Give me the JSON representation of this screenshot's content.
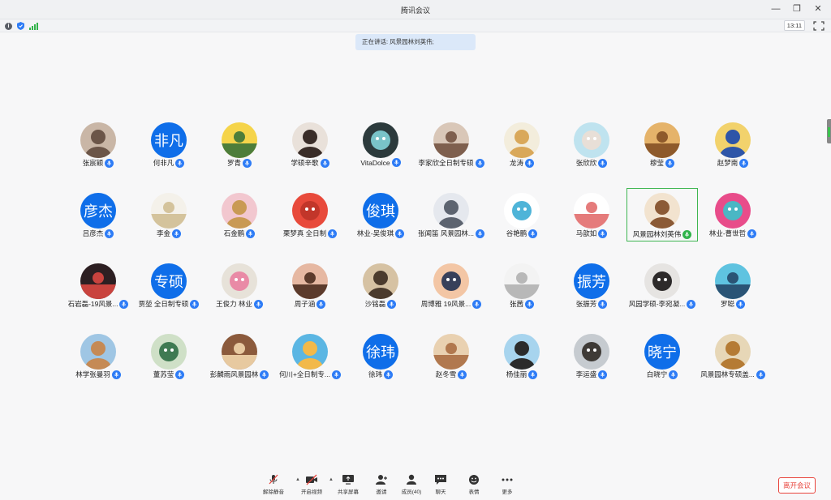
{
  "window": {
    "title": "腾讯会议"
  },
  "status": {
    "time": "13:11"
  },
  "speaking": {
    "text": "正在讲话: 风景园林刘英伟;"
  },
  "participants": [
    {
      "name": "张宸颖",
      "avatar": "photo",
      "colors": [
        "#c9b6a6",
        "#6b5548"
      ]
    },
    {
      "name": "何非凡",
      "avatar": "text",
      "text": "非凡"
    },
    {
      "name": "罗青",
      "avatar": "photo",
      "colors": [
        "#f5d44a",
        "#4d7d3a"
      ]
    },
    {
      "name": "学硕辛歌",
      "avatar": "photo",
      "colors": [
        "#e9e1da",
        "#3a2d28"
      ]
    },
    {
      "name": "VitaDolce",
      "avatar": "photo",
      "colors": [
        "#2c3a3c",
        "#79c3c8"
      ]
    },
    {
      "name": "李家欣全日制专硕",
      "avatar": "photo",
      "colors": [
        "#d9c7b8",
        "#7e5f4e"
      ]
    },
    {
      "name": "龙涛",
      "avatar": "photo",
      "colors": [
        "#f3eddc",
        "#d9a85a"
      ]
    },
    {
      "name": "张欣欣",
      "avatar": "photo",
      "colors": [
        "#bfe3ef",
        "#e8dfd7"
      ]
    },
    {
      "name": "穆莹",
      "avatar": "photo",
      "colors": [
        "#e5b36a",
        "#8e5a2b"
      ]
    },
    {
      "name": "赵梦南",
      "avatar": "photo",
      "colors": [
        "#f2d26c",
        "#2e55a8"
      ]
    },
    {
      "name": "吕彦杰",
      "avatar": "text",
      "text": "彦杰"
    },
    {
      "name": "李金",
      "avatar": "photo",
      "colors": [
        "#f4f1ea",
        "#d4c39c"
      ]
    },
    {
      "name": "石金鹏",
      "avatar": "photo",
      "colors": [
        "#f2c7cf",
        "#c99a54"
      ]
    },
    {
      "name": "栗梦真 全日制",
      "avatar": "photo",
      "colors": [
        "#e84a3b",
        "#c2362a"
      ]
    },
    {
      "name": "林业-吴俊琪",
      "avatar": "text",
      "text": "俊琪"
    },
    {
      "name": "张闻笛 风景园林...",
      "avatar": "photo",
      "colors": [
        "#e5e8ee",
        "#5d6470"
      ]
    },
    {
      "name": "谷艳鹏",
      "avatar": "photo",
      "colors": [
        "#ffffff",
        "#4fb4d8"
      ]
    },
    {
      "name": "马歆如",
      "avatar": "photo",
      "colors": [
        "#ffffff",
        "#e57b7b"
      ]
    },
    {
      "name": "风景园林刘英伟",
      "avatar": "photo",
      "colors": [
        "#f2e3cf",
        "#8b5a36"
      ],
      "active": true
    },
    {
      "name": "林业-曹世哲",
      "avatar": "photo",
      "colors": [
        "#e84c8a",
        "#4ab7c4"
      ]
    },
    {
      "name": "石岩磊-19风景...",
      "avatar": "photo",
      "colors": [
        "#2d1f22",
        "#c9433e"
      ]
    },
    {
      "name": "贾堃 全日制专硕",
      "avatar": "text",
      "text": "专硕"
    },
    {
      "name": "王俊力 林业",
      "avatar": "photo",
      "colors": [
        "#e7e2d9",
        "#e98aa6"
      ]
    },
    {
      "name": "周子涵",
      "avatar": "photo",
      "colors": [
        "#e6b8a2",
        "#5c3b2c"
      ]
    },
    {
      "name": "沙铭磊",
      "avatar": "photo",
      "colors": [
        "#d6c2a3",
        "#4b3b2d"
      ]
    },
    {
      "name": "周博雅 19风景...",
      "avatar": "photo",
      "colors": [
        "#f3c6a5",
        "#38405a"
      ]
    },
    {
      "name": "张茜",
      "avatar": "photo",
      "colors": [
        "#f3f3f3",
        "#b8b8b8"
      ]
    },
    {
      "name": "张振芳",
      "avatar": "text",
      "text": "振芳"
    },
    {
      "name": "风园学硕-李宛凝...",
      "avatar": "photo",
      "colors": [
        "#e6e4e2",
        "#2d2a2a"
      ]
    },
    {
      "name": "罗聪",
      "avatar": "photo",
      "colors": [
        "#5fc3e0",
        "#2a5475"
      ]
    },
    {
      "name": "林学张曼羽",
      "avatar": "photo",
      "colors": [
        "#9fc6e4",
        "#c58a55"
      ]
    },
    {
      "name": "董苏莹",
      "avatar": "photo",
      "colors": [
        "#cfe0c7",
        "#3f7a52"
      ]
    },
    {
      "name": "彭麟雨风景园林",
      "avatar": "photo",
      "colors": [
        "#8b5a3c",
        "#e7c9a0"
      ]
    },
    {
      "name": "何川+全日制专...",
      "avatar": "photo",
      "colors": [
        "#5bb6e3",
        "#f2b94a"
      ]
    },
    {
      "name": "徐玮",
      "avatar": "text",
      "text": "徐玮"
    },
    {
      "name": "赵冬雪",
      "avatar": "photo",
      "colors": [
        "#e9d1b1",
        "#b1784e"
      ]
    },
    {
      "name": "杨佳丽",
      "avatar": "photo",
      "colors": [
        "#a7d4ee",
        "#2b2b2b"
      ]
    },
    {
      "name": "李运盛",
      "avatar": "photo",
      "colors": [
        "#c6cbd0",
        "#3e3a36"
      ]
    },
    {
      "name": "白晓宁",
      "avatar": "text",
      "text": "晓宁"
    },
    {
      "name": "风景园林专硕盖...",
      "avatar": "photo",
      "colors": [
        "#e7d7b7",
        "#b57b34"
      ]
    }
  ],
  "toolbar": {
    "items": [
      {
        "label": "解除静音",
        "icon": "mic-muted-icon"
      },
      {
        "label": "开启视频",
        "icon": "video-off-icon"
      },
      {
        "label": "共享屏幕",
        "icon": "screen-share-icon"
      },
      {
        "label": "邀请",
        "icon": "invite-icon"
      },
      {
        "label": "成员(40)",
        "icon": "members-icon"
      },
      {
        "label": "聊天",
        "icon": "chat-icon"
      },
      {
        "label": "表情",
        "icon": "emoji-icon"
      },
      {
        "label": "更多",
        "icon": "more-icon"
      }
    ],
    "leave_label": "离开会议"
  }
}
